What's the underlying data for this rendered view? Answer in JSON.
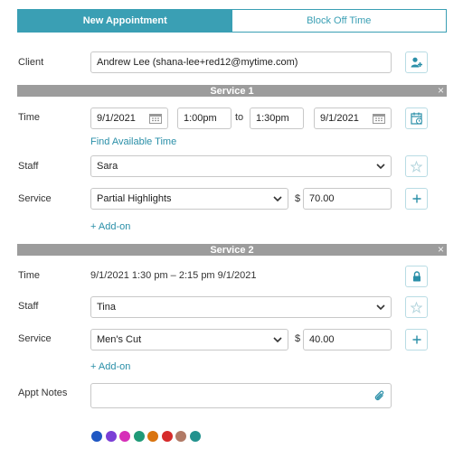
{
  "tabs": [
    {
      "label": "New Appointment"
    },
    {
      "label": "Block Off Time"
    }
  ],
  "client": {
    "label": "Client",
    "value": "Andrew Lee (shana-lee+red12@mytime.com)",
    "add_icon": "add-client-icon"
  },
  "service1": {
    "header": "Service 1",
    "close": "×",
    "time_label": "Time",
    "start_date": "9/1/2021",
    "start_time": "1:00pm",
    "to": "to",
    "end_time": "1:30pm",
    "end_date": "9/1/2021",
    "find_time": "Find Available Time",
    "staff_label": "Staff",
    "staff": "Sara",
    "service_label": "Service",
    "service": "Partial Highlights",
    "currency": "$",
    "price": "70.00",
    "addon": "+ Add-on"
  },
  "service2": {
    "header": "Service 2",
    "close": "×",
    "time_label": "Time",
    "time_text": "9/1/2021 1:30 pm – 2:15 pm 9/1/2021",
    "staff_label": "Staff",
    "staff": "Tina",
    "service_label": "Service",
    "service": "Men's Cut",
    "currency": "$",
    "price": "40.00",
    "addon": "+ Add-on"
  },
  "notes": {
    "label": "Appt Notes",
    "value": "",
    "icon": "paperclip-icon"
  },
  "colors": {
    "accent": "#3a9fb4",
    "swatches": [
      "#1f57c3",
      "#7b3fd6",
      "#d62fb8",
      "#1f9a78",
      "#d9740f",
      "#d62b2b",
      "#b17a66",
      "#23928e"
    ]
  }
}
